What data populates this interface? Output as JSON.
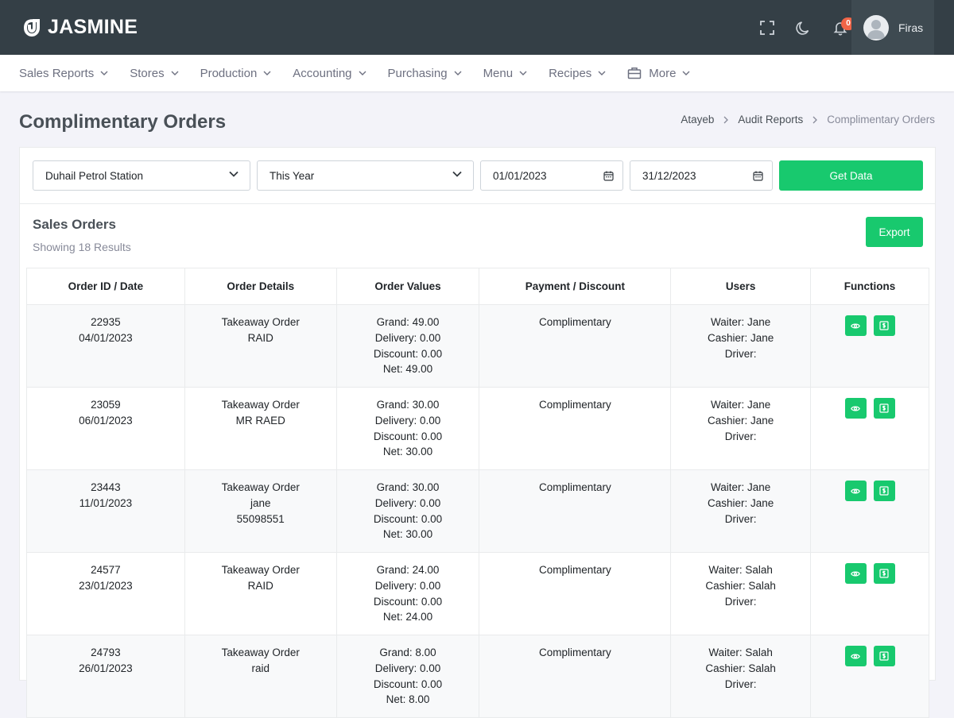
{
  "brand": {
    "name": "JASMINE"
  },
  "header": {
    "notification_count": "0",
    "user_name": "Firas"
  },
  "nav": [
    "Sales Reports",
    "Stores",
    "Production",
    "Accounting",
    "Purchasing",
    "Menu",
    "Recipes",
    "More"
  ],
  "page": {
    "title": "Complimentary Orders",
    "breadcrumb": [
      "Atayeb",
      "Audit Reports",
      "Complimentary Orders"
    ]
  },
  "filters": {
    "store": "Duhail Petrol Station",
    "period": "This Year",
    "date_from": "01/01/2023",
    "date_to": "31/12/2023",
    "get_data_label": "Get Data"
  },
  "results": {
    "title": "Sales Orders",
    "count_text": "Showing 18 Results",
    "export_label": "Export",
    "columns": [
      "Order ID / Date",
      "Order Details",
      "Order Values",
      "Payment / Discount",
      "Users",
      "Functions"
    ],
    "rows": [
      {
        "id": "22935",
        "date": "04/01/2023",
        "details": [
          "Takeaway Order",
          "RAID"
        ],
        "values": [
          "Grand: 49.00",
          "Delivery: 0.00",
          "Discount: 0.00",
          "Net: 49.00"
        ],
        "payment": "Complimentary",
        "users": [
          "Waiter: Jane",
          "Cashier: Jane",
          "Driver:"
        ]
      },
      {
        "id": "23059",
        "date": "06/01/2023",
        "details": [
          "Takeaway Order",
          "MR RAED"
        ],
        "values": [
          "Grand: 30.00",
          "Delivery: 0.00",
          "Discount: 0.00",
          "Net: 30.00"
        ],
        "payment": "Complimentary",
        "users": [
          "Waiter: Jane",
          "Cashier: Jane",
          "Driver:"
        ]
      },
      {
        "id": "23443",
        "date": "11/01/2023",
        "details": [
          "Takeaway Order",
          "jane",
          "55098551"
        ],
        "values": [
          "Grand: 30.00",
          "Delivery: 0.00",
          "Discount: 0.00",
          "Net: 30.00"
        ],
        "payment": "Complimentary",
        "users": [
          "Waiter: Jane",
          "Cashier: Jane",
          "Driver:"
        ]
      },
      {
        "id": "24577",
        "date": "23/01/2023",
        "details": [
          "Takeaway Order",
          "RAID"
        ],
        "values": [
          "Grand: 24.00",
          "Delivery: 0.00",
          "Discount: 0.00",
          "Net: 24.00"
        ],
        "payment": "Complimentary",
        "users": [
          "Waiter: Salah",
          "Cashier: Salah",
          "Driver:"
        ]
      },
      {
        "id": "24793",
        "date": "26/01/2023",
        "details": [
          "Takeaway Order",
          "raid"
        ],
        "values": [
          "Grand: 8.00",
          "Delivery: 0.00",
          "Discount: 0.00",
          "Net: 8.00"
        ],
        "payment": "Complimentary",
        "users": [
          "Waiter: Salah",
          "Cashier: Salah",
          "Driver:"
        ]
      }
    ]
  },
  "colors": {
    "header_bg": "#343f46",
    "accent_green": "#18c96e",
    "badge_red": "#f06548"
  },
  "icons": [
    "fullscreen-icon",
    "moon-icon",
    "bell-icon",
    "user-avatar-icon",
    "chevron-down-icon",
    "briefcase-icon",
    "calendar-icon",
    "eye-icon",
    "dollar-bill-icon"
  ]
}
